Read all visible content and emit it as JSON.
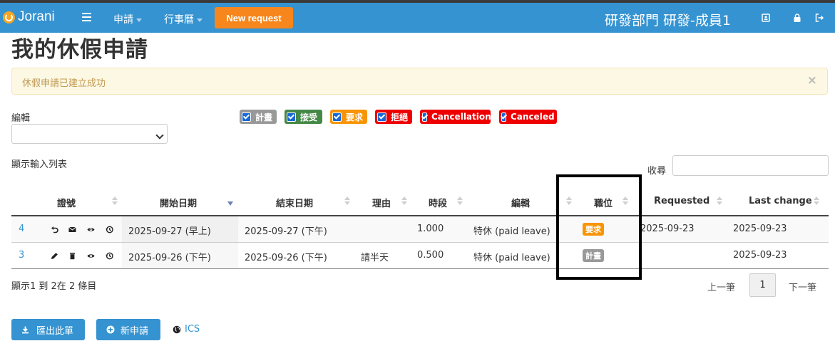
{
  "nav": {
    "brand": "Jorani",
    "menu_request": "申請",
    "menu_calendar": "行事曆",
    "new_request": "New request",
    "user": "研發部門 研發-成員1"
  },
  "page": {
    "title": "我的休假申請",
    "alert": "休假申請已建立成功",
    "alert_close": "×"
  },
  "filters": {
    "edit_label": "編輯",
    "select_value": "",
    "chips": [
      {
        "label": "計畫",
        "color": "#999999",
        "checked": true
      },
      {
        "label": "接受",
        "color": "#468847",
        "checked": true
      },
      {
        "label": "要求",
        "color": "#f89406",
        "checked": true
      },
      {
        "label": "拒絕",
        "color": "#ee0000",
        "checked": true
      },
      {
        "label": "Cancellation",
        "color": "#ee0000",
        "checked": true
      },
      {
        "label": "Canceled",
        "color": "#ee0000",
        "checked": true
      }
    ]
  },
  "table": {
    "show_list": "顯示輸入列表",
    "search_label": "收尋",
    "search_value": "",
    "columns": [
      "證號",
      "開始日期",
      "結束日期",
      "理由",
      "時段",
      "編輯",
      "職位",
      "Requested",
      "Last change"
    ],
    "rows": [
      {
        "id": "4",
        "start": "2025-09-27 (早上)",
        "end": "2025-09-27 (下午)",
        "reason": "",
        "duration": "1.000",
        "type": "特休 (paid leave)",
        "status": "要求",
        "status_color": "#f89406",
        "requested": "2025-09-23",
        "last_change": "2025-09-23",
        "actions": [
          "undo-icon",
          "email-icon",
          "view-icon",
          "history-icon"
        ]
      },
      {
        "id": "3",
        "start": "2025-09-26 (下午)",
        "end": "2025-09-26 (下午)",
        "reason": "請半天",
        "duration": "0.500",
        "type": "特休 (paid leave)",
        "status": "計畫",
        "status_color": "#999999",
        "requested": "",
        "last_change": "2025-09-23",
        "actions": [
          "edit-icon",
          "delete-icon",
          "view-icon",
          "history-icon"
        ]
      }
    ]
  },
  "footer": {
    "info": "顯示1 到 2在 2 條目",
    "prev": "上一筆",
    "page": "1",
    "next": "下一筆",
    "export": "匯出此單",
    "new_request": "新申請",
    "ics": "ICS"
  }
}
